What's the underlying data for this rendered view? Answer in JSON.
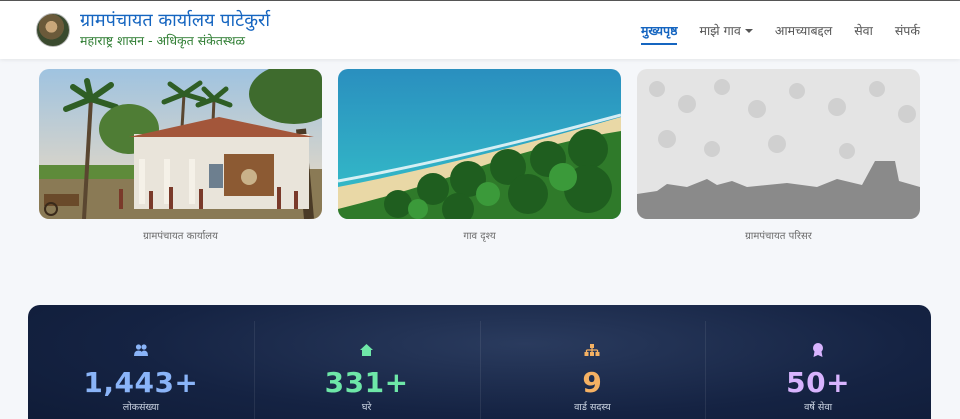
{
  "header": {
    "title": "ग्रामपंचायत कार्यालय पाटेकुर्रा",
    "subtitle": "महाराष्ट्र शासन - अधिकृत संकेतस्थळ"
  },
  "nav": {
    "items": [
      {
        "label": "मुख्यपृष्ठ",
        "active": true
      },
      {
        "label": "माझे गाव",
        "dropdown": true
      },
      {
        "label": "आमच्याबद्दल"
      },
      {
        "label": "सेवा"
      },
      {
        "label": "संपर्क"
      }
    ]
  },
  "gallery": [
    {
      "caption": "ग्रामपंचायत कार्यालय",
      "image": "village-office-photo"
    },
    {
      "caption": "गाव दृश्य",
      "image": "beach-coconut-trees-photo"
    },
    {
      "caption": "ग्रामपंचायत परिसर",
      "image": "crowd-silhouette-photo"
    }
  ],
  "stats": [
    {
      "value": "1,443+",
      "label": "लोकसंख्या",
      "icon": "people-icon",
      "color": "#8ab4f8"
    },
    {
      "value": "331+",
      "label": "घरे",
      "icon": "house-icon",
      "color": "#6ee7a8"
    },
    {
      "value": "9",
      "label": "वार्ड सदस्य",
      "icon": "hierarchy-icon",
      "color": "#f5b163"
    },
    {
      "value": "50+",
      "label": "वर्षे सेवा",
      "icon": "award-icon",
      "color": "#d8b4fe"
    }
  ],
  "theme": {
    "primary": "#1565c0",
    "subtitle_green": "#2e7d32",
    "stats_bg": "#152343"
  }
}
